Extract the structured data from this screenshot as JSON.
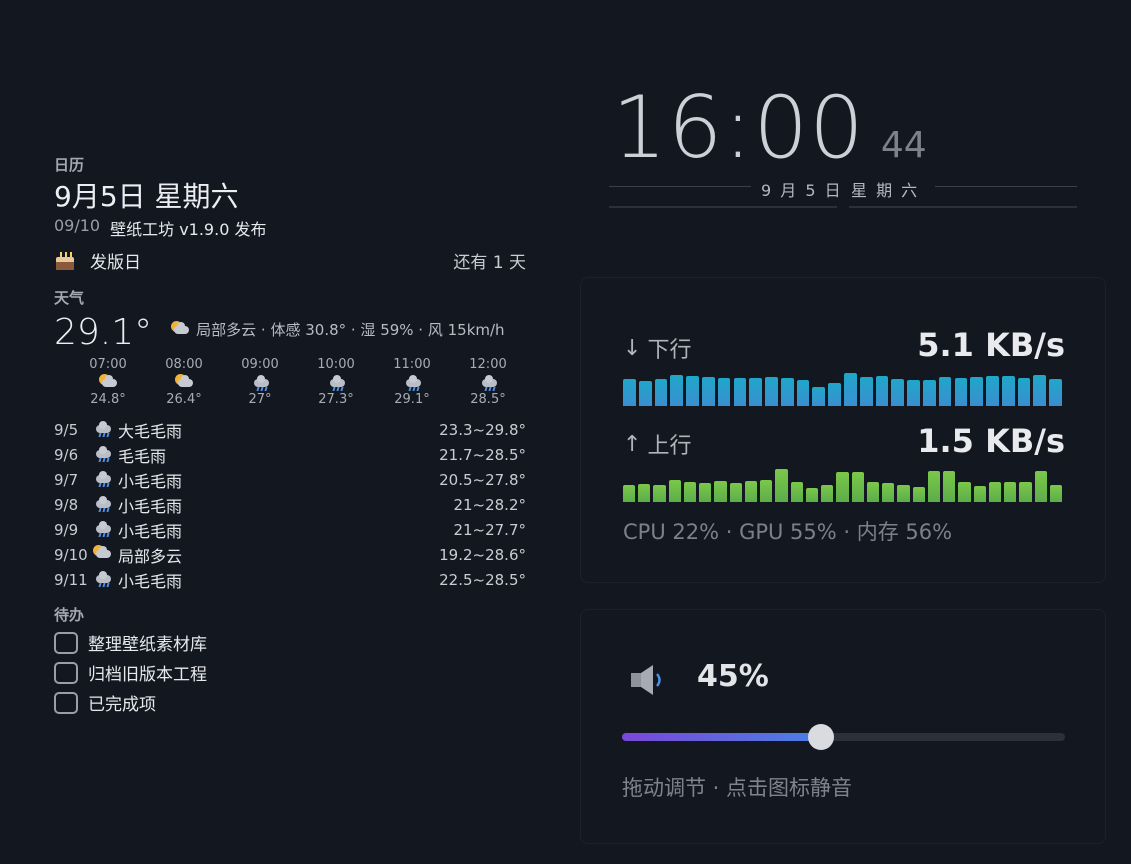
{
  "calendar": {
    "label": "日历",
    "date": "9月5日  星期六",
    "event_date": "09/10",
    "event_title": "壁纸工坊 v1.9.0 发布",
    "release_name": "发版日",
    "release_countdown": "还有 1 天"
  },
  "weather": {
    "label": "天气",
    "temp": "29.1°",
    "current_icon": "partly-cloudy-icon",
    "desc": "局部多云 · 体感 30.8° · 湿 59% · 风 15km/h",
    "hourly": [
      {
        "time": "07:00",
        "icon": "partly-cloudy-icon",
        "temp": "24.8°"
      },
      {
        "time": "08:00",
        "icon": "partly-cloudy-icon",
        "temp": "26.4°"
      },
      {
        "time": "09:00",
        "icon": "light-rain-icon",
        "temp": "27°"
      },
      {
        "time": "10:00",
        "icon": "light-rain-icon",
        "temp": "27.3°"
      },
      {
        "time": "11:00",
        "icon": "light-rain-icon",
        "temp": "29.1°"
      },
      {
        "time": "12:00",
        "icon": "light-rain-icon",
        "temp": "28.5°"
      }
    ],
    "daily": [
      {
        "date": "9/5",
        "icon": "heavy-drizzle-icon",
        "desc": "大毛毛雨",
        "range": "23.3~29.8°"
      },
      {
        "date": "9/6",
        "icon": "drizzle-icon",
        "desc": "毛毛雨",
        "range": "21.7~28.5°"
      },
      {
        "date": "9/7",
        "icon": "light-drizzle-icon",
        "desc": "小毛毛雨",
        "range": "20.5~27.8°"
      },
      {
        "date": "9/8",
        "icon": "light-drizzle-icon",
        "desc": "小毛毛雨",
        "range": "21~28.2°"
      },
      {
        "date": "9/9",
        "icon": "light-drizzle-icon",
        "desc": "小毛毛雨",
        "range": "21~27.7°"
      },
      {
        "date": "9/10",
        "icon": "partly-cloudy-icon",
        "desc": "局部多云",
        "range": "19.2~28.6°"
      },
      {
        "date": "9/11",
        "icon": "light-drizzle-icon",
        "desc": "小毛毛雨",
        "range": "22.5~28.5°"
      }
    ]
  },
  "todo": {
    "label": "待办",
    "items": [
      "整理壁纸素材库",
      "归档旧版本工程",
      "已完成项"
    ]
  },
  "clock": {
    "hm": "16:00",
    "seconds": "44",
    "date": "9 月 5 日",
    "weekday": "星 期 六"
  },
  "network": {
    "down_label": "下行",
    "down_value": "5.1 KB/s",
    "down_history": [
      0.78,
      0.74,
      0.8,
      0.9,
      0.87,
      0.85,
      0.81,
      0.82,
      0.83,
      0.84,
      0.81,
      0.76,
      0.55,
      0.68,
      0.96,
      0.86,
      0.88,
      0.78,
      0.75,
      0.76,
      0.84,
      0.83,
      0.84,
      0.88,
      0.87,
      0.83,
      0.91,
      0.8
    ],
    "down_color": "#3a8ed0",
    "up_label": "上行",
    "up_value": "1.5 KB/s",
    "up_history": [
      0.5,
      0.52,
      0.5,
      0.66,
      0.6,
      0.55,
      0.62,
      0.55,
      0.62,
      0.65,
      0.97,
      0.6,
      0.4,
      0.5,
      0.87,
      0.87,
      0.58,
      0.55,
      0.5,
      0.45,
      0.9,
      0.9,
      0.58,
      0.48,
      0.58,
      0.58,
      0.58,
      0.92,
      0.5
    ],
    "up_color": "#5cad4a",
    "sys_stats": "CPU 22% · GPU 55% · 内存 56%"
  },
  "volume": {
    "icon": "speaker-icon",
    "value_text": "45%",
    "level": 0.45,
    "hint": "拖动调节 · 点击图标静音"
  }
}
